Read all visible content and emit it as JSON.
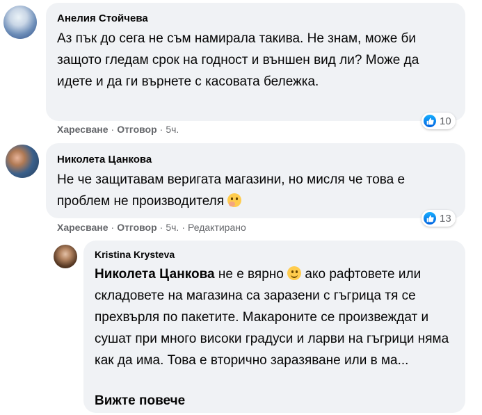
{
  "comments": [
    {
      "author": "Анелия Стойчева",
      "text": "Аз пък до сега не съм намирала такива. Не знам, може би защото гледам срок на годност и външен вид ли? Може да идете и да ги върнете с касовата бележка.",
      "actions": {
        "like": "Харесване",
        "reply": "Отговор",
        "time": "5ч."
      },
      "reaction_count": "10"
    },
    {
      "author": "Николета Цанкова",
      "text": "Не че защитавам веригата магазини, но мисля че това е проблем не производителя",
      "emoji": "thinking-face",
      "actions": {
        "like": "Харесване",
        "reply": "Отговор",
        "time": "5ч.",
        "edited": "Редактирано"
      },
      "reaction_count": "13"
    }
  ],
  "reply": {
    "author": "Kristina Krysteva",
    "mention": "Николета Цанкова",
    "text_before_emoji": " не е вярно ",
    "emoji": "smiling-face",
    "text_after_emoji": " ако рафтовете или складовете на магазина са заразени с гъгрица тя се прехвърля по пакетите. Макароните се произвеждат и сушат при много високи градуси и ларви на гъгрици няма как да има. Това е вторично заразяване или в ма...",
    "see_more": "Вижте повече"
  },
  "separator": "·",
  "colors": {
    "bubble": "#f0f2f5",
    "meta": "#65676b",
    "like_blue": "#0866ff"
  }
}
